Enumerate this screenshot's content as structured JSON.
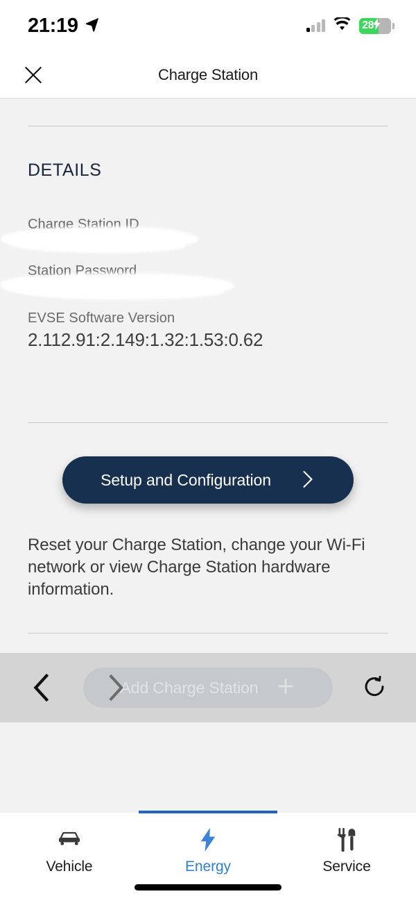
{
  "status_bar": {
    "time": "21:19",
    "location_icon": "location-arrow-icon",
    "signal_icon": "cellular-signal-icon",
    "wifi_icon": "wifi-icon",
    "battery_percent": "28",
    "battery_icon": "battery-charging-icon"
  },
  "header": {
    "close_icon": "close-icon",
    "title": "Charge Station"
  },
  "details": {
    "section_title": "DETAILS",
    "fields": [
      {
        "label": "Charge Station ID",
        "value": "",
        "redacted": true
      },
      {
        "label": "Station Password",
        "value": "",
        "redacted": true
      },
      {
        "label": "EVSE Software Version",
        "value": "2.112.91:2.149:1.32:1.53:0.62",
        "redacted": false
      }
    ]
  },
  "cta": {
    "label": "Setup and Configuration",
    "chevron_icon": "chevron-right-icon",
    "color": "#17304f"
  },
  "help": {
    "text": "Reset your Charge Station, change your Wi-Fi network or view Charge Station hardware information."
  },
  "overlay_bar": {
    "back_icon": "chevron-left-icon",
    "forward_icon": "chevron-right-icon",
    "add_label": "Add Charge Station",
    "add_icon": "plus-icon",
    "reload_icon": "reload-icon"
  },
  "tab_bar": {
    "active_color": "#2f7fd8",
    "tabs": [
      {
        "label": "Vehicle",
        "icon": "car-icon",
        "active": false
      },
      {
        "label": "Energy",
        "icon": "lightning-bolt-icon",
        "active": true
      },
      {
        "label": "Service",
        "icon": "wrench-screwdriver-icon",
        "active": true
      }
    ]
  }
}
